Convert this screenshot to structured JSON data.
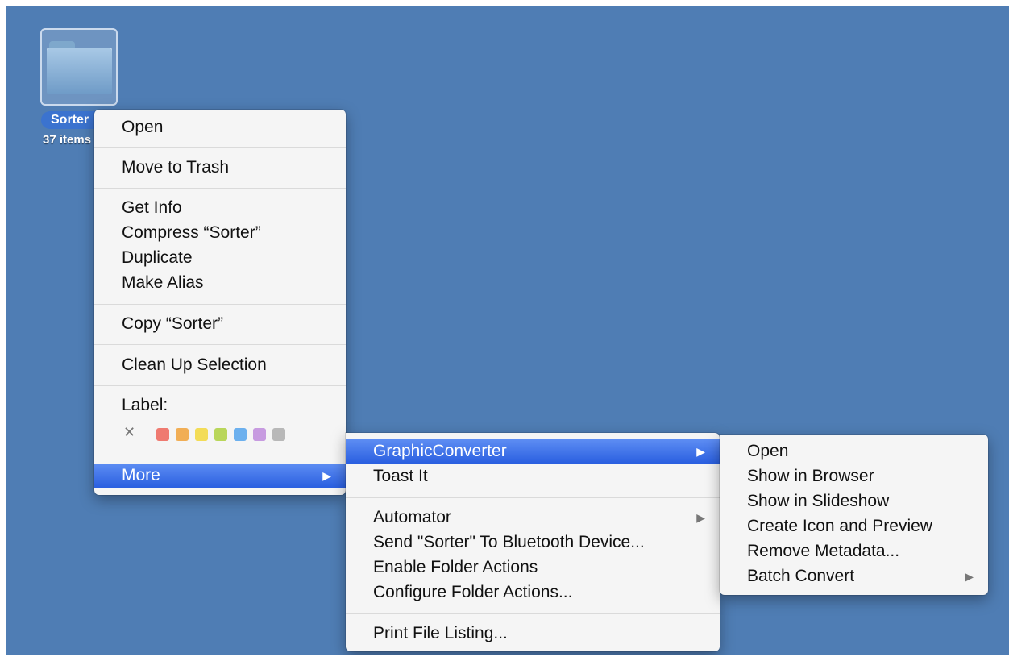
{
  "desktop": {
    "folder": {
      "name": "Sorter",
      "subtitle": "37 items"
    }
  },
  "context_menu": {
    "items": {
      "open": "Open",
      "move_to_trash": "Move to Trash",
      "get_info": "Get Info",
      "compress": "Compress “Sorter”",
      "duplicate": "Duplicate",
      "make_alias": "Make Alias",
      "copy": "Copy “Sorter”",
      "clean_up": "Clean Up Selection",
      "label": "Label:",
      "more": "More"
    },
    "label_colors": [
      "#ef7a70",
      "#f1ae55",
      "#f3dc57",
      "#b9d65a",
      "#6cb0ee",
      "#c79be0",
      "#b8b8b8"
    ]
  },
  "more_submenu": {
    "items": {
      "graphicconverter": "GraphicConverter",
      "toast_it": "Toast It",
      "automator": "Automator",
      "send_bluetooth": "Send \"Sorter\" To Bluetooth Device...",
      "enable_folder_actions": "Enable Folder Actions",
      "configure_folder_actions": "Configure Folder Actions...",
      "print_file_listing": "Print File Listing..."
    }
  },
  "gc_submenu": {
    "items": {
      "open": "Open",
      "show_in_browser": "Show in Browser",
      "show_in_slideshow": "Show in Slideshow",
      "create_icon_preview": "Create Icon and Preview",
      "remove_metadata": "Remove Metadata...",
      "batch_convert": "Batch Convert"
    }
  },
  "accent_color": "#3b73cf"
}
